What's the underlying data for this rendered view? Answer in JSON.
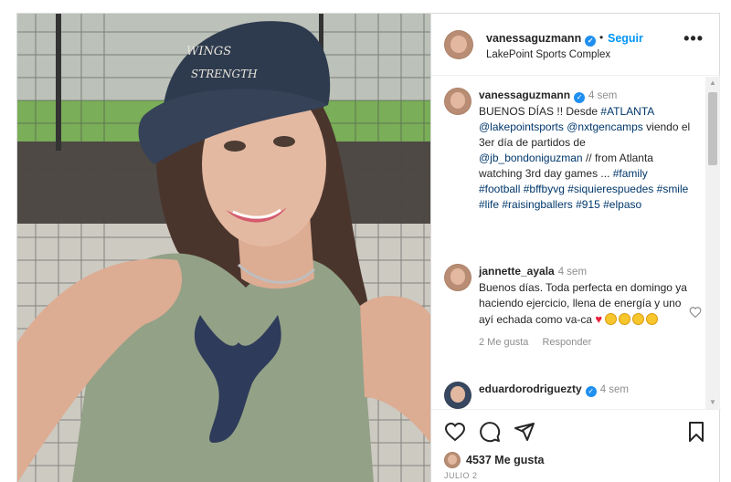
{
  "header": {
    "username": "vanessaguzmann",
    "verified_mark": "✓",
    "separator": "•",
    "follow_label": "Seguir",
    "location": "LakePoint Sports Complex",
    "more_icon": "more-options-icon"
  },
  "caption": {
    "username": "vanessaguzmann",
    "time": "4 sem",
    "text_parts": [
      "BUENOS DÍAS !! Desde ",
      "#ATLANTA",
      " ",
      "@lakepointsports",
      " ",
      "@nxtgencamps",
      " viendo el 3er día de partidos de ",
      "@jb_bondoniguzman",
      " // from Atlanta watching 3rd day games ... ",
      "#family",
      " ",
      "#football",
      " ",
      "#bffbyvg",
      " ",
      "#siquierespuedes",
      " ",
      "#smile",
      " ",
      "#life",
      " ",
      "#raisingballers",
      " ",
      "#915",
      " ",
      "#elpaso"
    ]
  },
  "comments": [
    {
      "username": "jannette_ayala",
      "time": "4 sem",
      "text": "Buenos días. Toda perfecta en domingo ya haciendo ejercicio, llena de energía y uno ayí echada como va-ca",
      "emoji_heart": "♥",
      "likes_label": "2 Me gusta",
      "reply_label": "Responder"
    },
    {
      "username": "eduardorodriguezty",
      "time": "4 sem"
    }
  ],
  "actions": {
    "like_icon": "heart-icon",
    "comment_icon": "comment-icon",
    "share_icon": "share-icon",
    "save_icon": "bookmark-icon"
  },
  "likes_text": "4537 Me gusta",
  "date": "JULIO 2",
  "colors": {
    "accent": "#0095f6",
    "link": "#00376b",
    "muted": "#8e8e8e",
    "cap": "#1d2a3f",
    "shirt": "#8a9a7d",
    "bull_logo": "#1e2b4c"
  }
}
